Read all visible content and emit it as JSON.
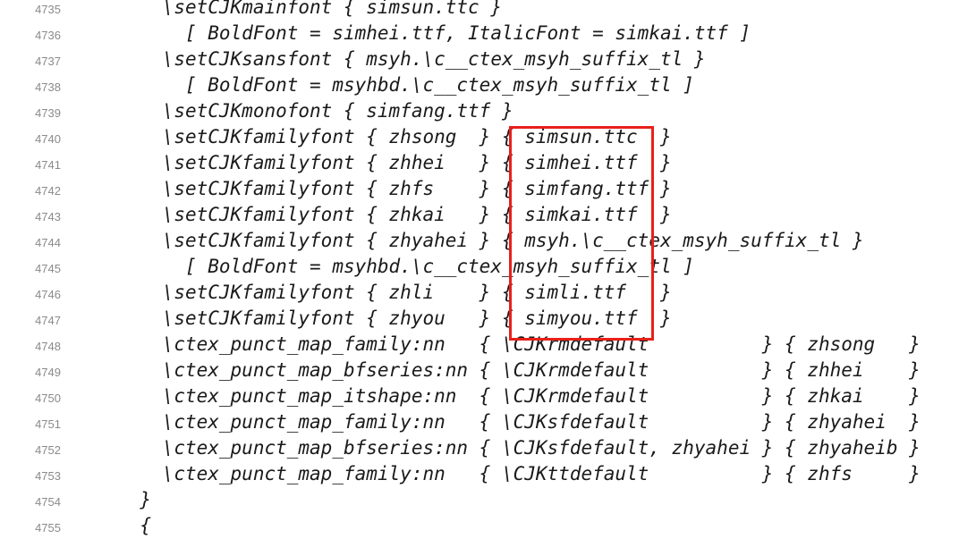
{
  "lines": [
    {
      "no": "4735",
      "indent": 12,
      "text": "\\setCJKmainfont { simsun.ttc }"
    },
    {
      "no": "4736",
      "indent": 14,
      "text": "[ BoldFont = simhei.ttf, ItalicFont = simkai.ttf ]"
    },
    {
      "no": "4737",
      "indent": 12,
      "text": "\\setCJKsansfont { msyh.\\c__ctex_msyh_suffix_tl }"
    },
    {
      "no": "4738",
      "indent": 14,
      "text": "[ BoldFont = msyhbd.\\c__ctex_msyh_suffix_tl ]"
    },
    {
      "no": "4739",
      "indent": 12,
      "text": "\\setCJKmonofont { simfang.ttf }"
    },
    {
      "no": "4740",
      "indent": 12,
      "text": "\\setCJKfamilyfont { zhsong  } { simsun.ttc  }"
    },
    {
      "no": "4741",
      "indent": 12,
      "text": "\\setCJKfamilyfont { zhhei   } { simhei.ttf  }"
    },
    {
      "no": "4742",
      "indent": 12,
      "text": "\\setCJKfamilyfont { zhfs    } { simfang.ttf }"
    },
    {
      "no": "4743",
      "indent": 12,
      "text": "\\setCJKfamilyfont { zhkai   } { simkai.ttf  }"
    },
    {
      "no": "4744",
      "indent": 12,
      "text": "\\setCJKfamilyfont { zhyahei } { msyh.\\c__ctex_msyh_suffix_tl }"
    },
    {
      "no": "4745",
      "indent": 14,
      "text": "[ BoldFont = msyhbd.\\c__ctex_msyh_suffix_tl ]"
    },
    {
      "no": "4746",
      "indent": 12,
      "text": "\\setCJKfamilyfont { zhli    } { simli.ttf   }"
    },
    {
      "no": "4747",
      "indent": 12,
      "text": "\\setCJKfamilyfont { zhyou   } { simyou.ttf  }"
    },
    {
      "no": "4748",
      "indent": 12,
      "text": "\\ctex_punct_map_family:nn   { \\CJKrmdefault          } { zhsong   }"
    },
    {
      "no": "4749",
      "indent": 12,
      "text": "\\ctex_punct_map_bfseries:nn { \\CJKrmdefault          } { zhhei    }"
    },
    {
      "no": "4750",
      "indent": 12,
      "text": "\\ctex_punct_map_itshape:nn  { \\CJKrmdefault          } { zhkai    }"
    },
    {
      "no": "4751",
      "indent": 12,
      "text": "\\ctex_punct_map_family:nn   { \\CJKsfdefault          } { zhyahei  }"
    },
    {
      "no": "4752",
      "indent": 12,
      "text": "\\ctex_punct_map_bfseries:nn { \\CJKsfdefault, zhyahei } { zhyaheib }"
    },
    {
      "no": "4753",
      "indent": 12,
      "text": "\\ctex_punct_map_family:nn   { \\CJKttdefault          } { zhfs     }"
    },
    {
      "no": "4754",
      "indent": 10,
      "text": "}"
    },
    {
      "no": "4755",
      "indent": 10,
      "text": "{"
    }
  ],
  "highlight": {
    "color": "#e8201a"
  }
}
